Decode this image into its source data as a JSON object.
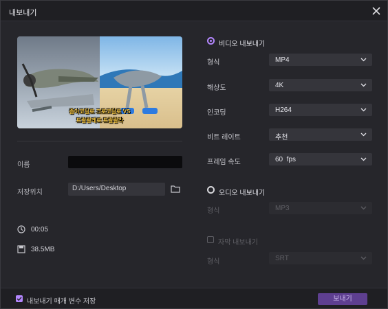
{
  "window": {
    "title": "내보내기"
  },
  "preview": {
    "caption_line1": "좀아코딜로 크로코딜로 VS",
    "caption_line2": "트랄랄레로 트랄랄라"
  },
  "file": {
    "name_label": "이름",
    "name_value": "",
    "location_label": "저장위치",
    "location_value": "D:/Users/Desktop",
    "duration": "00:05",
    "size": "38.5MB"
  },
  "video_export": {
    "label": "비디오 내보내기",
    "selected": true,
    "fields": [
      {
        "label": "형식",
        "value": "MP4"
      },
      {
        "label": "해상도",
        "value": "4K"
      },
      {
        "label": "인코딩",
        "value": "H264"
      },
      {
        "label": "비트 레이트",
        "value": "추천"
      },
      {
        "label": "프레임 속도",
        "value": "60  fps"
      }
    ]
  },
  "audio_export": {
    "label": "오디오 내보내기",
    "selected": false,
    "fields": [
      {
        "label": "형식",
        "value": "MP3"
      }
    ]
  },
  "subtitle_export": {
    "label": "자막 내보내기",
    "checked": false,
    "fields": [
      {
        "label": "형식",
        "value": "SRT"
      }
    ]
  },
  "footer": {
    "save_params_label": "내보내기 매개 변수 저장",
    "save_params_checked": true,
    "export_button": "보내기"
  },
  "colors": {
    "accent": "#b487ff",
    "button": "#5e3f90",
    "background": "#26262b"
  },
  "icons": [
    "close-icon",
    "folder-icon",
    "clock-icon",
    "save-icon",
    "chevron-down-icon"
  ]
}
